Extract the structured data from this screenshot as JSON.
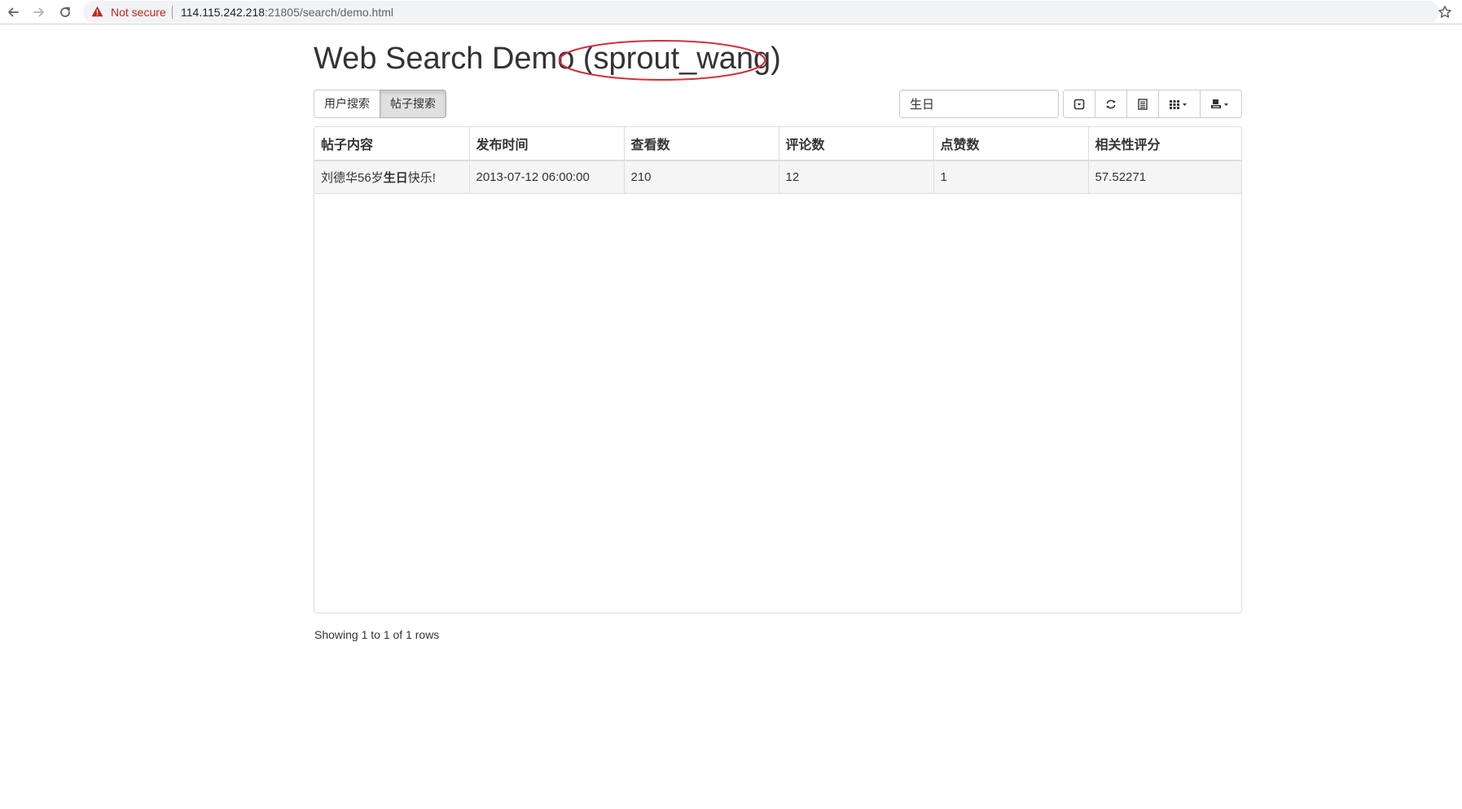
{
  "browser": {
    "security_label": "Not secure",
    "url_host": "114.115.242.218",
    "url_rest": ":21805/search/demo.html"
  },
  "page": {
    "title_main": "Web Search Demo ",
    "title_user": "(sprout_wang)"
  },
  "tabs": [
    {
      "label": "用户搜索",
      "active": false
    },
    {
      "label": "帖子搜索",
      "active": true
    }
  ],
  "search": {
    "value": "生日"
  },
  "toolbar": {
    "icons": [
      "toggle-icon",
      "refresh-icon",
      "columns-list-icon",
      "columns-grid-icon",
      "export-icon"
    ]
  },
  "table": {
    "columns": [
      "帖子内容",
      "发布时间",
      "查看数",
      "评论数",
      "点赞数",
      "相关性评分"
    ],
    "rows": [
      {
        "content_before": "刘德华56岁",
        "content_highlight": "生日",
        "content_after": "快乐!",
        "time": "2013-07-12 06:00:00",
        "views": "210",
        "comments": "12",
        "likes": "1",
        "score": "57.52271"
      }
    ]
  },
  "pagination": {
    "info": "Showing 1 to 1 of 1 rows"
  },
  "colors": {
    "annotation_ellipse": "#d0303a",
    "warning": "#c5221f"
  }
}
